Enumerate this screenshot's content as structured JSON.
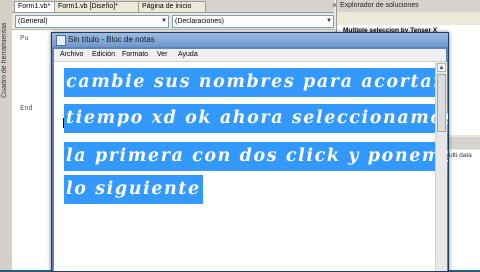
{
  "vs": {
    "tabs": [
      "Form1.vb*",
      "Form1.vb [Diseño]*",
      "Página de inicio"
    ],
    "tab_close": "×",
    "combo_left": "(General)",
    "combo_right": "(Declaraciones)",
    "toolbox_label": "Cuadro de herramientas",
    "code_lines": [
      "Pu",
      "End"
    ],
    "solution_explorer": {
      "title": "Explorador de soluciones",
      "item": "Multiple seleccion by Tenser X"
    },
    "properties_text": "ulti data"
  },
  "notepad": {
    "title": "Sin título - Bloc de notas",
    "menu": [
      "Archivo",
      "Edición",
      "Formato",
      "Ver",
      "Ayuda"
    ],
    "lines": [
      "cambie sus nombres para acortar",
      "tiempo xd ok ahora seleccionamos",
      "la primera con dos click y ponemos",
      "lo siguiente"
    ],
    "selection_color": "#3399ff"
  },
  "icons": {
    "scroll_up": "▲",
    "combo_arrow": "▼"
  }
}
